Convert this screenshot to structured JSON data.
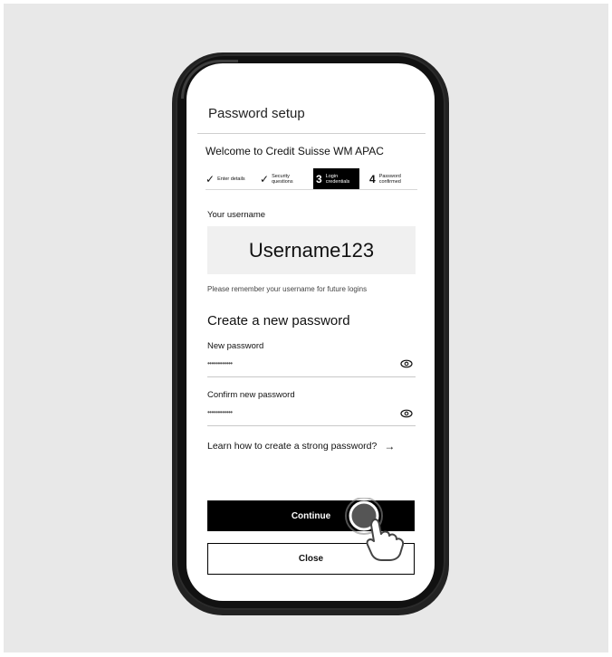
{
  "screen": {
    "title": "Password setup",
    "welcome": "Welcome to Credit Suisse WM APAC",
    "steps": [
      {
        "state": "done",
        "label": "Enter details"
      },
      {
        "state": "done",
        "label": "Security questions"
      },
      {
        "number": "3",
        "state": "active",
        "label": "Login credentials"
      },
      {
        "number": "4",
        "state": "pending",
        "label": "Password confirmed"
      }
    ],
    "username_label": "Your username",
    "username_value": "Username123",
    "username_hint": "Please remember your username for future logins",
    "create_heading": "Create a new password",
    "new_password": {
      "label": "New password",
      "value": "••••••••••••"
    },
    "confirm_password": {
      "label": "Confirm new password",
      "value": "••••••••••••"
    },
    "learn_link": "Learn how to create a strong password?",
    "learn_arrow": "→",
    "check_icon": "checkmark-icon",
    "eye_icon": "eye-icon",
    "continue_label": "Continue",
    "close_label": "Close"
  }
}
